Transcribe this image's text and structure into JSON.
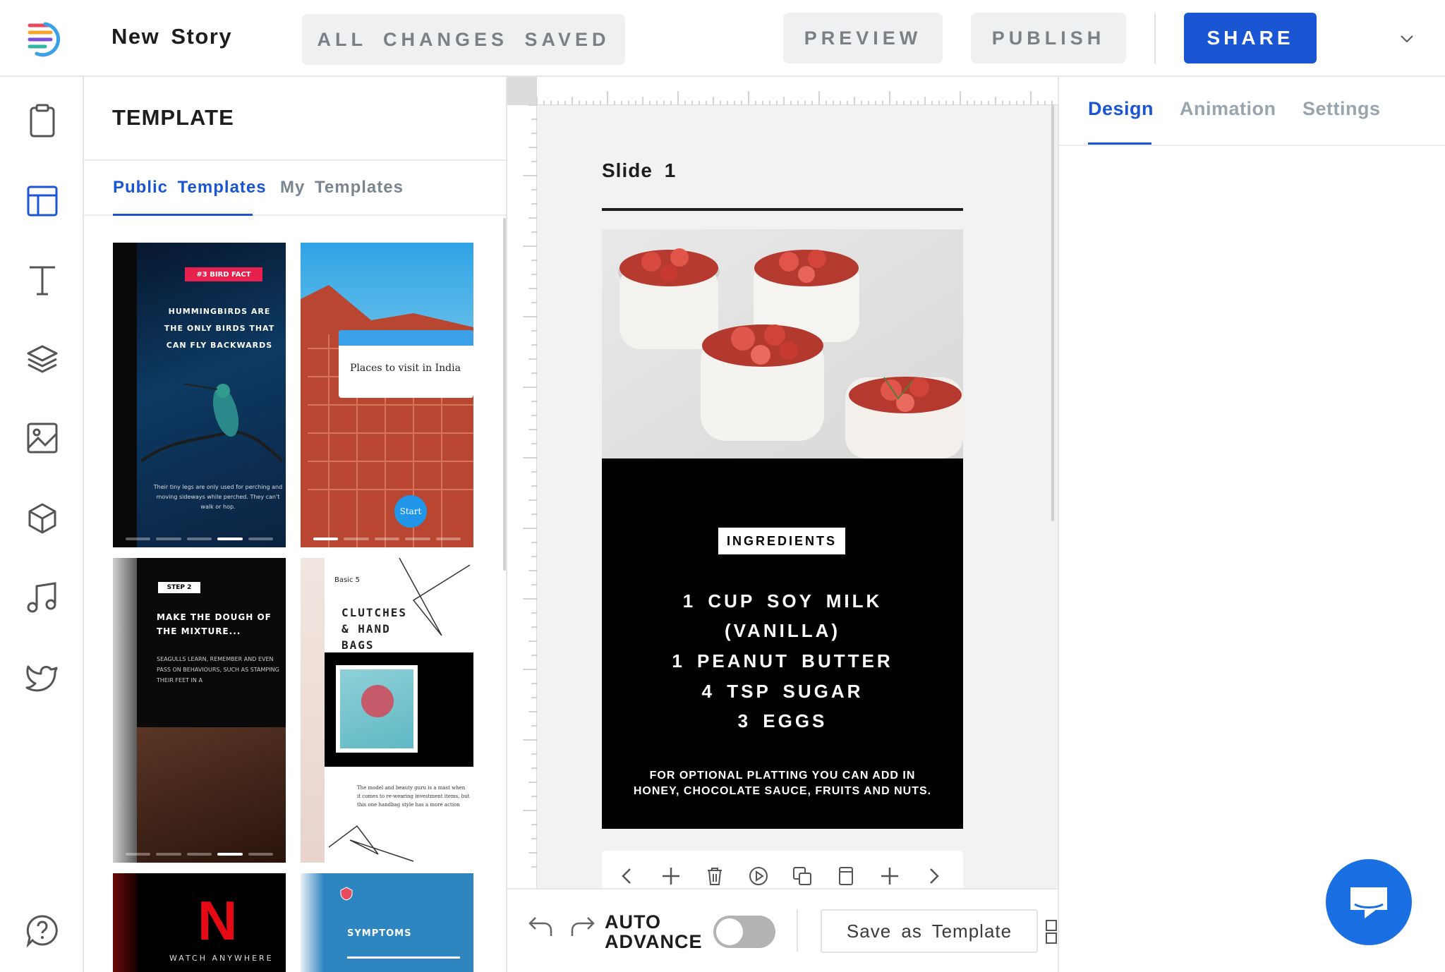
{
  "app": {
    "story_title": "New Story",
    "save_status": "ALL CHANGES SAVED",
    "preview_label": "PREVIEW",
    "publish_label": "PUBLISH",
    "share_label": "SHARE",
    "accent_color": "#1a56d3"
  },
  "rail": {
    "items": [
      {
        "name": "clipboard-icon",
        "active": false
      },
      {
        "name": "template-icon",
        "active": true
      },
      {
        "name": "text-icon",
        "active": false
      },
      {
        "name": "layers-icon",
        "active": false
      },
      {
        "name": "image-icon",
        "active": false
      },
      {
        "name": "cube-icon",
        "active": false
      },
      {
        "name": "music-icon",
        "active": false
      },
      {
        "name": "twitter-icon",
        "active": false
      },
      {
        "name": "help-icon",
        "active": false
      }
    ]
  },
  "template_panel": {
    "heading": "TEMPLATE",
    "tabs": [
      "Public Templates",
      "My Templates"
    ],
    "active_tab": "Public Templates",
    "thumbnails": [
      {
        "tag": "#3 BIRD FACT",
        "headline": "HUMMINGBIRDS ARE THE ONLY BIRDS THAT CAN FLY BACKWARDS",
        "body": "Their tiny legs are only used for perching and moving sideways while perched. They can't walk or hop."
      },
      {
        "card_title": "Places to visit in India",
        "button": "Start"
      },
      {
        "tag": "STEP 2",
        "headline": "MAKE THE DOUGH OF THE MIXTURE...",
        "body": "SEAGULLS LEARN, REMEMBER AND EVEN PASS ON BEHAVIOURS, SUCH AS STAMPING THEIR FEET IN A"
      },
      {
        "kicker": "Basic 5",
        "headline": "CLUTCHES & HAND BAGS",
        "body": "The model and beauty guru is a mast when it comes to re-wearing investment items, but this one handbag style has a more action"
      },
      {
        "logo": "N",
        "caption": "WATCH ANYWHERE"
      },
      {
        "caption": "SYMPTOMS"
      }
    ]
  },
  "canvas": {
    "slide_label": "Slide 1",
    "ingredients_badge": "INGREDIENTS",
    "ingredients": [
      "1 CUP SOY MILK",
      "(VANILLA)",
      "1 PEANUT BUTTER",
      "4 TSP SUGAR",
      "3 EGGS"
    ],
    "note_line1": "FOR OPTIONAL PLATTING YOU CAN ADD IN",
    "note_line2": "HONEY, CHOCOLATE SAUCE, FRUITS AND NUTS."
  },
  "bottom_bar": {
    "auto_advance_line1": "AUTO",
    "auto_advance_line2": "ADVANCE",
    "auto_advance_on": false,
    "save_template_label": "Save as Template"
  },
  "right_panel": {
    "tabs": [
      "Design",
      "Animation",
      "Settings"
    ],
    "active_tab": "Design"
  }
}
